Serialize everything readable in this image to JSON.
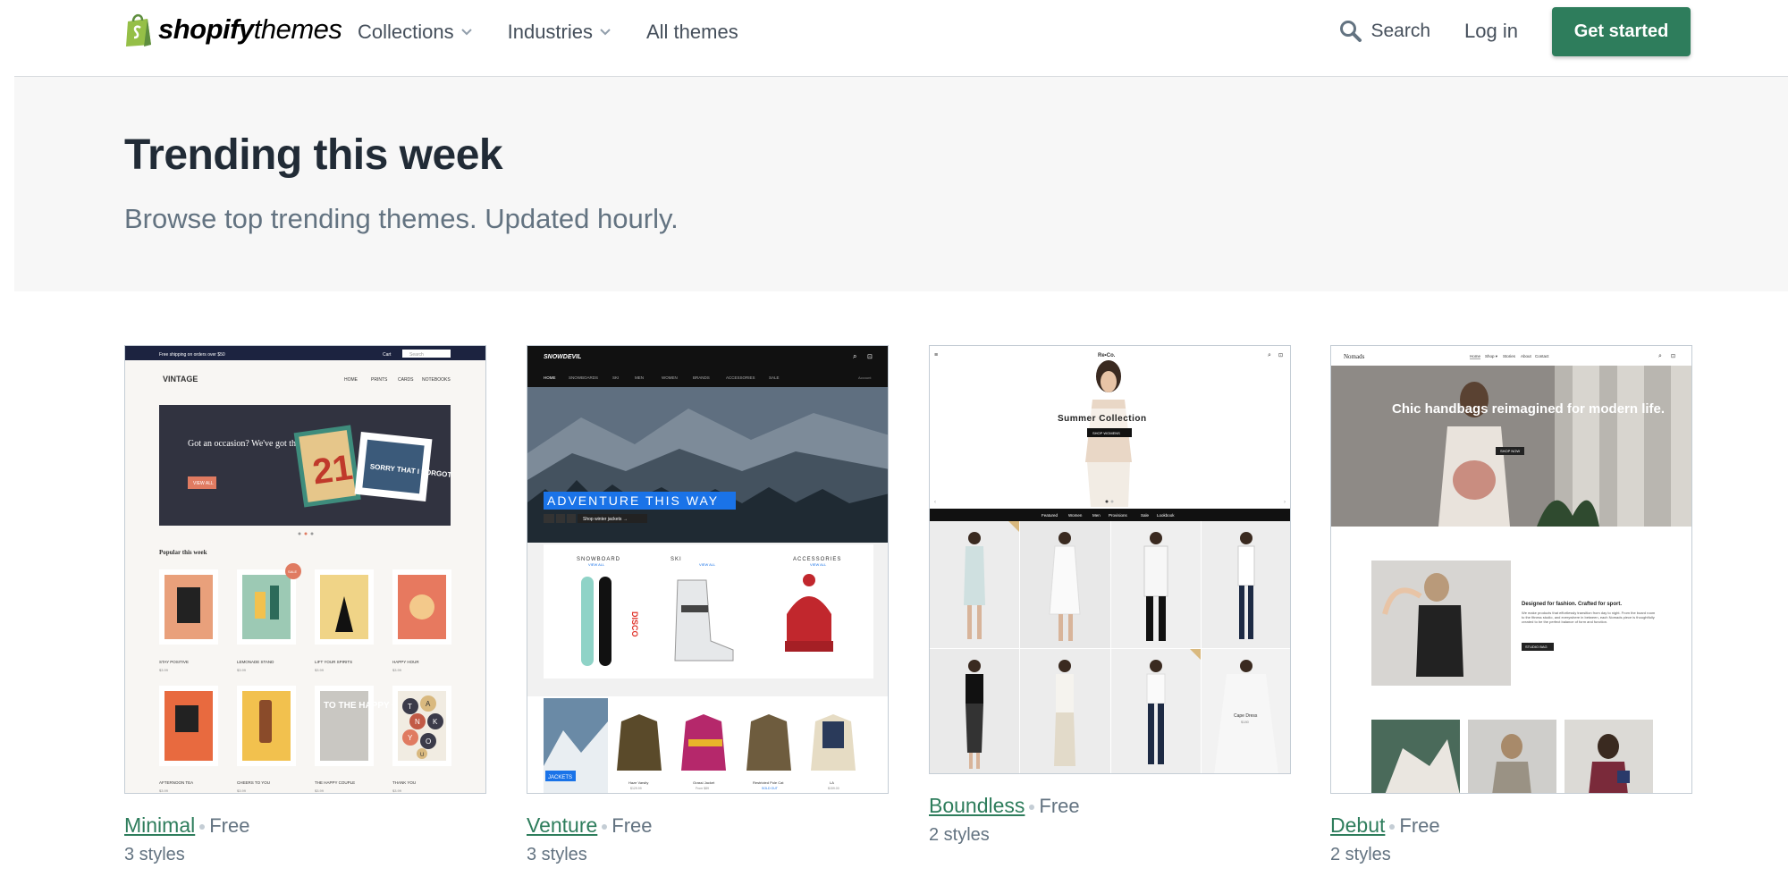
{
  "header": {
    "logo_bold": "shopify",
    "logo_light": "themes",
    "nav": [
      {
        "label": "Collections",
        "has_dropdown": true
      },
      {
        "label": "Industries",
        "has_dropdown": true
      },
      {
        "label": "All themes",
        "has_dropdown": false
      }
    ],
    "search_label": "Search",
    "login_label": "Log in",
    "cta_label": "Get started"
  },
  "hero": {
    "title": "Trending this week",
    "subtitle": "Browse top trending themes. Updated hourly."
  },
  "themes": [
    {
      "name": "Minimal",
      "price": "Free",
      "styles": "3 styles",
      "preview": {
        "topbar": "Free shipping on orders over $50",
        "cart": "Cart",
        "search": "Search",
        "brand": "VINTAGE",
        "nav": [
          "HOME",
          "PRINTS",
          "CARDS",
          "NOTEBOOKS"
        ],
        "banner_text": "Got an occasion? We've got the card.",
        "banner_button": "VIEW ALL",
        "card_number": "21",
        "card_text": "SORRY THAT I FORGOT",
        "section_title": "Popular this week",
        "sale_badge": "SALE",
        "products_row1": [
          "STAY POSITIVE",
          "LEMONADE STAND",
          "LIFT YOUR SPIRITS",
          "HAPPY HOUR"
        ],
        "products_row2": [
          "AFTERNOON TEA",
          "CHEERS TO YOU",
          "THE HAPPY COUPLE",
          "THANK YOU"
        ],
        "price": "$3.99",
        "card3_text": "TO THE HAPPY COUPLE",
        "card4_letters": [
          "T",
          "A",
          "N",
          "K",
          "Y",
          "O",
          "U"
        ]
      }
    },
    {
      "name": "Venture",
      "price": "Free",
      "styles": "3 styles",
      "preview": {
        "brand": "SNOWDEVIL",
        "nav": [
          "HOME",
          "SNOWBOARDS",
          "SKI",
          "MEN",
          "WOMEN",
          "BRANDS",
          "ACCESSORIES",
          "SALE"
        ],
        "account": "Account",
        "headline": "ADVENTURE THIS WAY",
        "sub_button": "Shop winter jackets →",
        "categories": [
          {
            "title": "SNOWBOARD",
            "link": "VIEW ALL"
          },
          {
            "title": "SKI",
            "link": "VIEW ALL"
          },
          {
            "title": "ACCESSORIES",
            "link": "VIEW ALL"
          }
        ],
        "board_text": "DISCO",
        "jackets_label": "JACKETS",
        "jackets": [
          {
            "name": "Haze Varsity",
            "price": "$129.99"
          },
          {
            "name": "Grassi Jacket",
            "price": "From $89"
          },
          {
            "name": "Restricted Pole Cat",
            "price": "SOLD OUT"
          },
          {
            "name": "LA",
            "price": "$159.00"
          }
        ],
        "colors": {
          "accent": "#1a73e8"
        }
      }
    },
    {
      "name": "Boundless",
      "price": "Free",
      "styles": "2 styles",
      "preview": {
        "brand": "Re•Co.",
        "headline": "Summer Collection",
        "button": "SHOP WOMENS",
        "nav": [
          "Featured",
          "Women",
          "Men",
          "Provisions",
          "Sale",
          "Lookbook"
        ],
        "tile_label": "Cape Dress",
        "tile_price": "$180"
      }
    },
    {
      "name": "Debut",
      "price": "Free",
      "styles": "2 styles",
      "preview": {
        "brand": "Nomads",
        "nav": [
          "Home",
          "Shop ▾",
          "Stories",
          "About",
          "Contact"
        ],
        "headline": "Chic handbags reimagined for modern life.",
        "button": "SHOP NOW",
        "feature_title": "Designed for fashion. Crafted for sport.",
        "feature_body": "We make products that effortlessly transition from day to night. From the board room to the fitness studio, and everywhere in between, each Nomads piece is thoughtfully created to be the perfect balance of form and function.",
        "feature_button": "STUDIO BAG"
      }
    }
  ]
}
